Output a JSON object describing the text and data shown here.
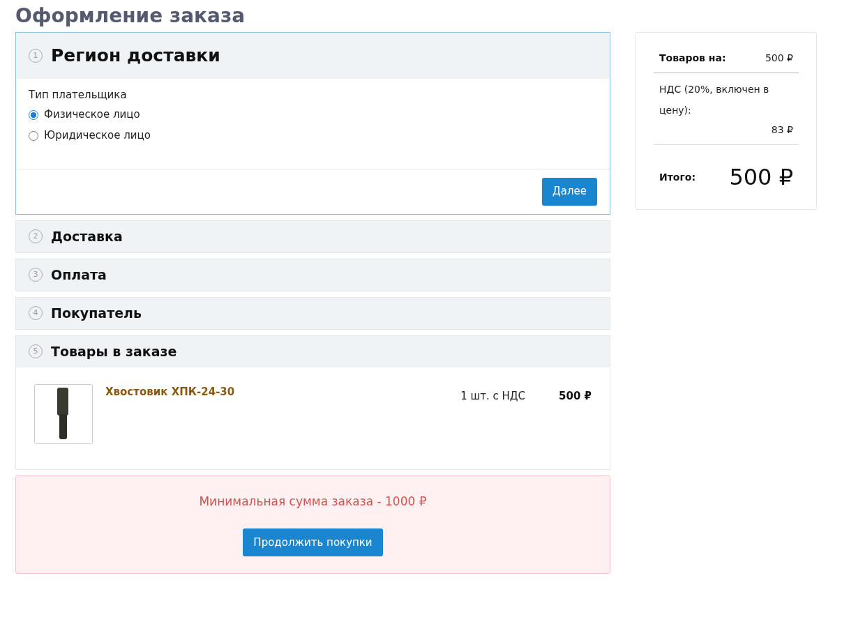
{
  "page_title": "Оформление заказа",
  "steps": [
    {
      "number": "1",
      "title": "Регион доставки",
      "selected": true,
      "kind": "payer",
      "payer": {
        "label": "Тип плательщика",
        "options": [
          {
            "label": "Физическое лицо",
            "selected": true
          },
          {
            "label": "Юридическое лицо",
            "selected": false
          }
        ]
      },
      "button": "Далее"
    },
    {
      "number": "2",
      "title": "Доставка",
      "selected": false,
      "kind": "plain"
    },
    {
      "number": "3",
      "title": "Оплата",
      "selected": false,
      "kind": "plain"
    },
    {
      "number": "4",
      "title": "Покупатель",
      "selected": false,
      "kind": "plain"
    },
    {
      "number": "5",
      "title": "Товары в заказе",
      "selected": false,
      "kind": "products",
      "items": [
        {
          "name": "Хвостовик ХПК-24-30",
          "quantity": "1 шт. с НДС",
          "price": "500 ₽"
        }
      ]
    }
  ],
  "alert": {
    "message": "Минимальная сумма заказа - 1000 ₽",
    "button": "Продолжить покупки"
  },
  "summary": {
    "goods_label": "Товаров на:",
    "goods_value": "500 ₽",
    "vat_label": "НДС (20%, включен в цену):",
    "vat_value": "83 ₽",
    "total_label": "Итого:",
    "total_value": "500 ₽"
  }
}
